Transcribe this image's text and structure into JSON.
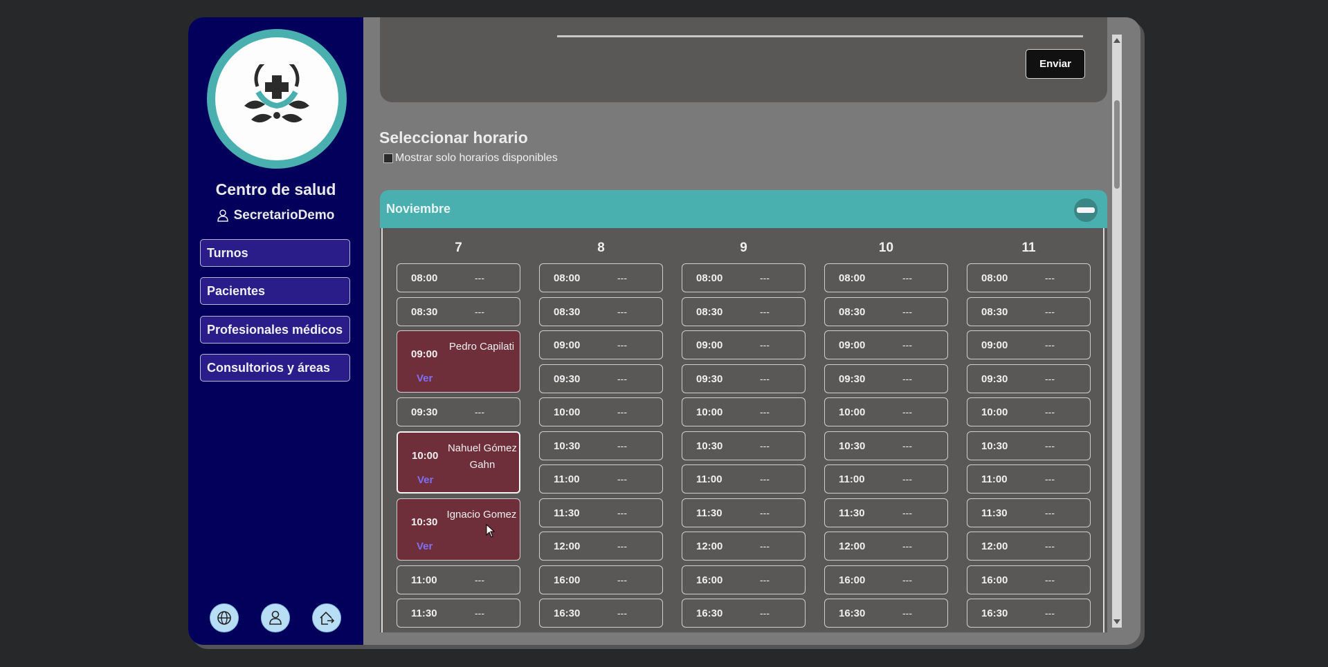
{
  "sidebar": {
    "org_name": "Centro de salud",
    "user_name": "SecretarioDemo",
    "nav": [
      "Turnos",
      "Pacientes",
      "Profesionales médicos",
      "Consultorios y áreas"
    ],
    "bottom_icons": [
      "globe-icon",
      "user-icon",
      "logout-icon"
    ]
  },
  "form": {
    "submit_label": "Enviar"
  },
  "schedule": {
    "title": "Seleccionar horario",
    "filter_label": "Mostrar solo horarios disponibles",
    "month": "Noviembre",
    "days": [
      {
        "label": "7",
        "slots": [
          {
            "time": "08:00",
            "detail": "---"
          },
          {
            "time": "08:30",
            "detail": "---"
          },
          {
            "time": "09:00",
            "patient": "Pedro Capilati",
            "link": "Ver"
          },
          {
            "time": "09:30",
            "detail": "---"
          },
          {
            "time": "10:00",
            "patient": "Nahuel Gómez Gahn",
            "link": "Ver",
            "active": true
          },
          {
            "time": "10:30",
            "patient": "Ignacio Gomez",
            "link": "Ver"
          },
          {
            "time": "11:00",
            "detail": "---"
          },
          {
            "time": "11:30",
            "detail": "---"
          }
        ]
      },
      {
        "label": "8",
        "slots": [
          {
            "time": "08:00",
            "detail": "---"
          },
          {
            "time": "08:30",
            "detail": "---"
          },
          {
            "time": "09:00",
            "detail": "---"
          },
          {
            "time": "09:30",
            "detail": "---"
          },
          {
            "time": "10:00",
            "detail": "---"
          },
          {
            "time": "10:30",
            "detail": "---"
          },
          {
            "time": "11:00",
            "detail": "---"
          },
          {
            "time": "11:30",
            "detail": "---"
          },
          {
            "time": "12:00",
            "detail": "---"
          },
          {
            "time": "16:00",
            "detail": "---"
          },
          {
            "time": "16:30",
            "detail": "---"
          }
        ]
      },
      {
        "label": "9",
        "slots": [
          {
            "time": "08:00",
            "detail": "---"
          },
          {
            "time": "08:30",
            "detail": "---"
          },
          {
            "time": "09:00",
            "detail": "---"
          },
          {
            "time": "09:30",
            "detail": "---"
          },
          {
            "time": "10:00",
            "detail": "---"
          },
          {
            "time": "10:30",
            "detail": "---"
          },
          {
            "time": "11:00",
            "detail": "---"
          },
          {
            "time": "11:30",
            "detail": "---"
          },
          {
            "time": "12:00",
            "detail": "---"
          },
          {
            "time": "16:00",
            "detail": "---"
          },
          {
            "time": "16:30",
            "detail": "---"
          }
        ]
      },
      {
        "label": "10",
        "slots": [
          {
            "time": "08:00",
            "detail": "---"
          },
          {
            "time": "08:30",
            "detail": "---"
          },
          {
            "time": "09:00",
            "detail": "---"
          },
          {
            "time": "09:30",
            "detail": "---"
          },
          {
            "time": "10:00",
            "detail": "---"
          },
          {
            "time": "10:30",
            "detail": "---"
          },
          {
            "time": "11:00",
            "detail": "---"
          },
          {
            "time": "11:30",
            "detail": "---"
          },
          {
            "time": "12:00",
            "detail": "---"
          },
          {
            "time": "16:00",
            "detail": "---"
          },
          {
            "time": "16:30",
            "detail": "---"
          }
        ]
      },
      {
        "label": "11",
        "slots": [
          {
            "time": "08:00",
            "detail": "---"
          },
          {
            "time": "08:30",
            "detail": "---"
          },
          {
            "time": "09:00",
            "detail": "---"
          },
          {
            "time": "09:30",
            "detail": "---"
          },
          {
            "time": "10:00",
            "detail": "---"
          },
          {
            "time": "10:30",
            "detail": "---"
          },
          {
            "time": "11:00",
            "detail": "---"
          },
          {
            "time": "11:30",
            "detail": "---"
          },
          {
            "time": "12:00",
            "detail": "---"
          },
          {
            "time": "16:00",
            "detail": "---"
          },
          {
            "time": "16:30",
            "detail": "---"
          }
        ]
      }
    ]
  },
  "colors": {
    "sidebar_bg": "#03005c",
    "accent_teal": "#4aafaf",
    "booked_slot": "#6e2f3a",
    "link": "#7e6ff6"
  }
}
